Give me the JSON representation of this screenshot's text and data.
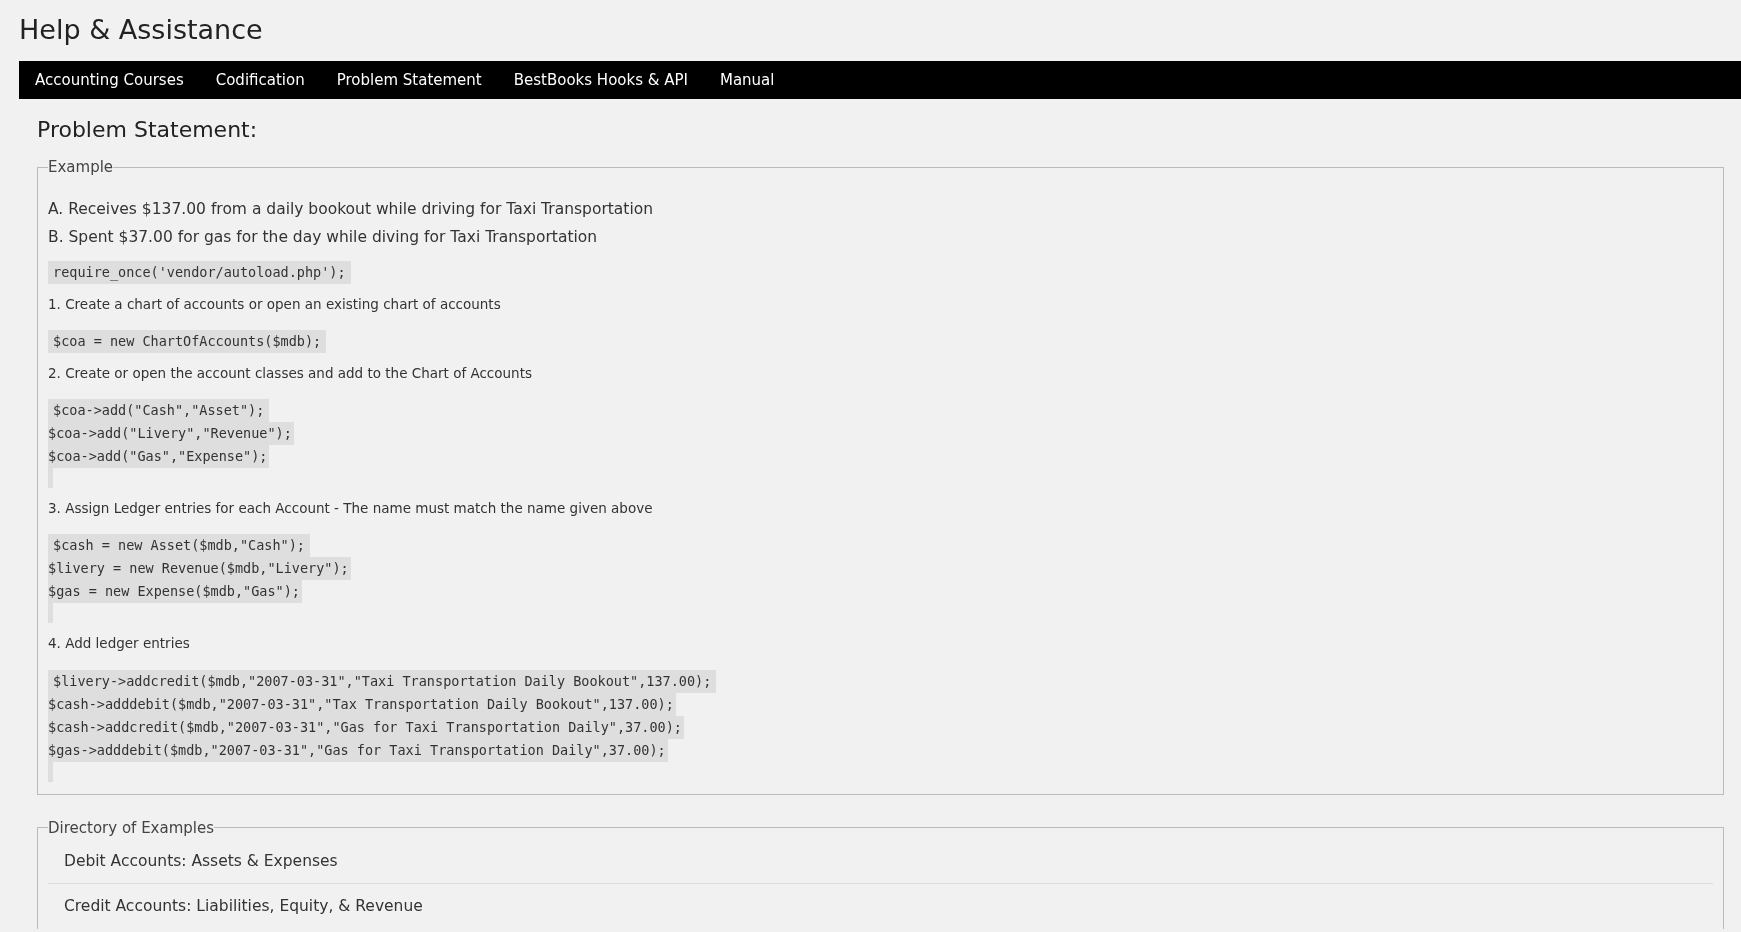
{
  "page_title": "Help & Assistance",
  "nav": [
    {
      "label": "Accounting Courses",
      "selected": false
    },
    {
      "label": "Codification",
      "selected": false
    },
    {
      "label": "Problem Statement",
      "selected": false
    },
    {
      "label": "BestBooks Hooks & API",
      "selected": false
    },
    {
      "label": "Manual",
      "selected": false
    }
  ],
  "heading": "Problem Statement:",
  "example": {
    "legend": "Example",
    "blocks": [
      {
        "kind": "paragraph",
        "text": "A. Receives $137.00 from a daily bookout while driving for Taxi Transportation"
      },
      {
        "kind": "paragraph",
        "text": "B. Spent $37.00 for gas for the day while diving for Taxi Transportation"
      },
      {
        "kind": "code",
        "lines": [
          "require_once('vendor/autoload.php');"
        ],
        "trailing_blank": false
      },
      {
        "kind": "step",
        "text": "1. Create a chart of accounts or open an existing chart of accounts"
      },
      {
        "kind": "code",
        "lines": [
          "$coa = new ChartOfAccounts($mdb);"
        ],
        "trailing_blank": false
      },
      {
        "kind": "step",
        "text": "2. Create or open the account classes and add to the Chart of Accounts"
      },
      {
        "kind": "code",
        "lines": [
          "$coa->add(\"Cash\",\"Asset\");",
          "$coa->add(\"Livery\",\"Revenue\");",
          "$coa->add(\"Gas\",\"Expense\");"
        ],
        "trailing_blank": true
      },
      {
        "kind": "step",
        "text": "3. Assign Ledger entries for each Account - The name must match the name given above"
      },
      {
        "kind": "code",
        "lines": [
          "$cash = new Asset($mdb,\"Cash\");",
          "$livery = new Revenue($mdb,\"Livery\");",
          "$gas = new Expense($mdb,\"Gas\");"
        ],
        "trailing_blank": true
      },
      {
        "kind": "step",
        "text": "4. Add ledger entries"
      },
      {
        "kind": "code",
        "lines": [
          "$livery->addcredit($mdb,\"2007-03-31\",\"Taxi Transportation Daily Bookout\",137.00);",
          "$cash->adddebit($mdb,\"2007-03-31\",\"Tax Transportation Daily Bookout\",137.00);",
          "$cash->addcredit($mdb,\"2007-03-31\",\"Gas for Taxi Transportation Daily\",37.00);",
          "$gas->adddebit($mdb,\"2007-03-31\",\"Gas for Taxi Transportation Daily\",37.00);"
        ],
        "trailing_blank": true
      }
    ]
  },
  "directory": {
    "legend": "Directory of Examples",
    "items": [
      "Debit Accounts: Assets & Expenses",
      "Credit Accounts: Liabilities, Equity, & Revenue"
    ]
  }
}
